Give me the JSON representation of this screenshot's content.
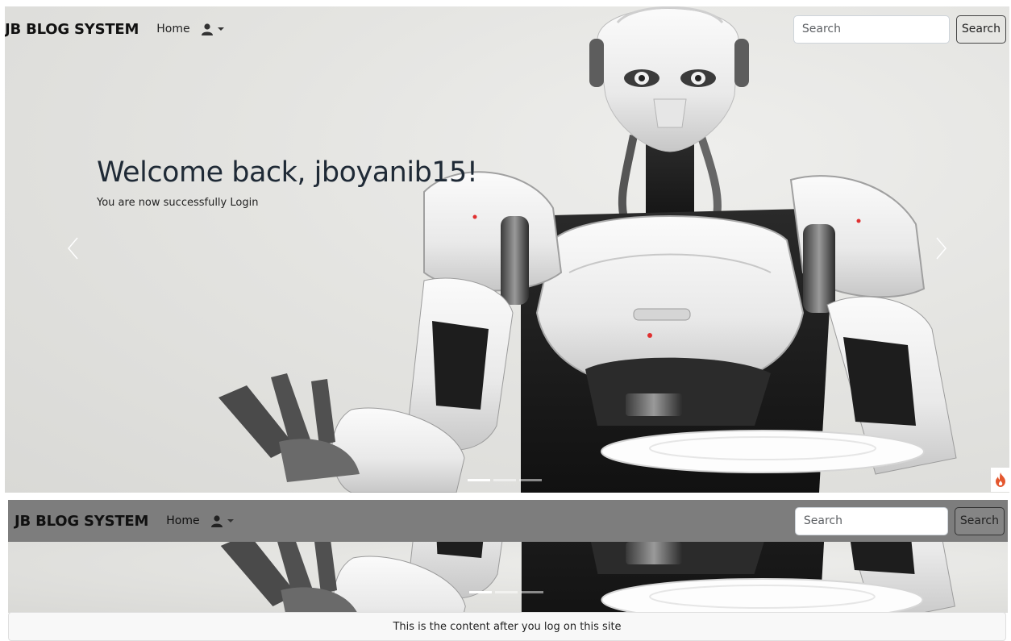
{
  "navbar": {
    "brand": "JB BLOG SYSTEM",
    "home_label": "Home",
    "user_icon": "user-icon",
    "search_placeholder": "Search",
    "search_button": "Search"
  },
  "hero": {
    "title": "Welcome back, jboyanib15!",
    "subtitle": "You are now successfully Login",
    "prev_icon": "chevron-left-icon",
    "next_icon": "chevron-right-icon",
    "slides_count": 3,
    "active_slide": 1
  },
  "content": {
    "message": "This is the content after you log on this site"
  },
  "colors": {
    "scrolled_navbar_bg": "#7d7d7d",
    "brand_text": "#111111",
    "fire_icon": "#e4572e"
  },
  "corner_icon": "fire-icon"
}
